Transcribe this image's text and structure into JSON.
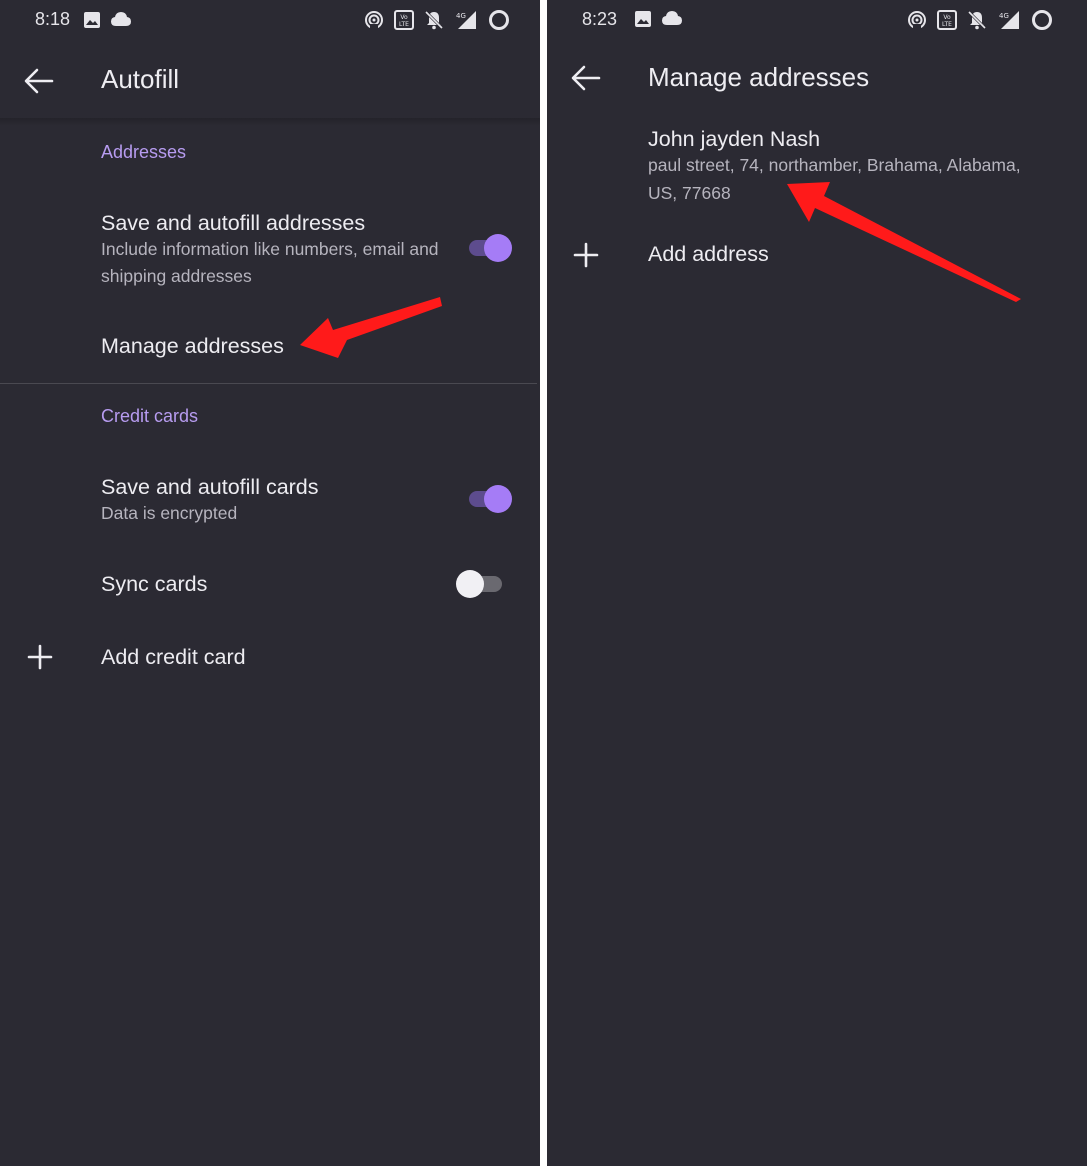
{
  "left": {
    "status": {
      "time": "8:18"
    },
    "title": "Autofill",
    "addresses_section": "Addresses",
    "save_addresses": {
      "title": "Save and autofill addresses",
      "subtitle": "Include information like numbers, email and shipping addresses",
      "enabled": true
    },
    "manage_addresses": "Manage addresses",
    "cards_section": "Credit cards",
    "save_cards": {
      "title": "Save and autofill cards",
      "subtitle": "Data is encrypted",
      "enabled": true
    },
    "sync_cards": {
      "title": "Sync cards",
      "enabled": false
    },
    "add_card": "Add credit card"
  },
  "right": {
    "status": {
      "time": "8:23"
    },
    "title": "Manage addresses",
    "address": {
      "name": "John jayden Nash",
      "line1": "paul street, 74, northamber, Brahama, Alabama,",
      "line2": "US, 77668"
    },
    "add_address": "Add address"
  },
  "status_icons": [
    "image-icon",
    "cloud-icon",
    "hotspot-icon",
    "volte-icon",
    "mute-icon",
    "signal-4g-icon",
    "battery-ring-icon"
  ],
  "colors": {
    "background": "#2b2a33",
    "accent": "#a57cf6",
    "section_header": "#b79cf0",
    "annotation_arrow": "#ff1a1a"
  }
}
